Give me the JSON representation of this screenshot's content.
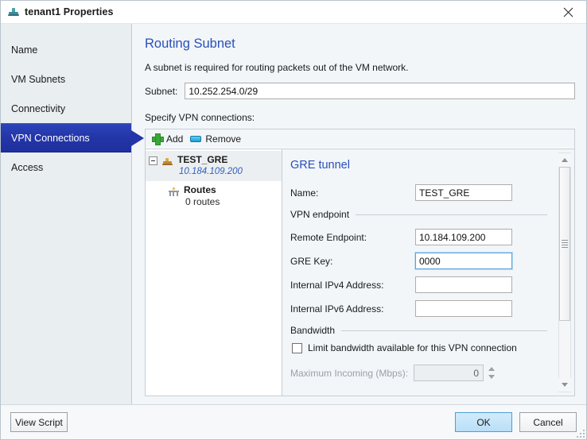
{
  "window": {
    "title": "tenant1 Properties",
    "icon": "network-tenant-icon",
    "close_label": "✕"
  },
  "sidebar": {
    "items": [
      {
        "label": "Name",
        "selected": false
      },
      {
        "label": "VM Subnets",
        "selected": false
      },
      {
        "label": "Connectivity",
        "selected": false
      },
      {
        "label": "VPN Connections",
        "selected": true
      },
      {
        "label": "Access",
        "selected": false
      }
    ]
  },
  "content": {
    "page_title": "Routing Subnet",
    "description": "A subnet is required for routing packets out of the VM network.",
    "subnet_label": "Subnet:",
    "subnet_value": "10.252.254.0/29",
    "subnet_placeholder": "",
    "specify_label": "Specify VPN connections:"
  },
  "toolbar": {
    "add_label": "Add",
    "remove_label": "Remove"
  },
  "tree": {
    "nodes": [
      {
        "title": "TEST_GRE",
        "subtitle": "10.184.109.200",
        "selected": true,
        "expanded": true
      },
      {
        "title": "Routes",
        "subtitle": "0 routes",
        "selected": false,
        "expanded": false
      }
    ]
  },
  "form": {
    "title": "GRE tunnel",
    "name_label": "Name:",
    "name_value": "TEST_GRE",
    "vpn_endpoint_group": "VPN endpoint",
    "remote_endpoint_label": "Remote Endpoint:",
    "remote_endpoint_value": "10.184.109.200",
    "gre_key_label": "GRE Key:",
    "gre_key_value": "0000",
    "internal_ipv4_label": "Internal IPv4 Address:",
    "internal_ipv4_value": "",
    "internal_ipv6_label": "Internal IPv6 Address:",
    "internal_ipv6_value": "",
    "bandwidth_group": "Bandwidth",
    "limit_bandwidth_label": "Limit bandwidth available for this VPN connection",
    "limit_bandwidth_checked": false,
    "max_incoming_label": "Maximum Incoming (Mbps):",
    "max_incoming_value": "0"
  },
  "footer": {
    "view_script_label": "View Script",
    "ok_label": "OK",
    "cancel_label": "Cancel"
  },
  "colors": {
    "accent_blue": "#2a4fb8",
    "selected_nav": "#2335a8",
    "link_italic": "#2f5fc0",
    "add_icon_green": "#3aa836",
    "remove_icon_blue": "#1d9fd4",
    "primary_button": "#b9dff8"
  }
}
